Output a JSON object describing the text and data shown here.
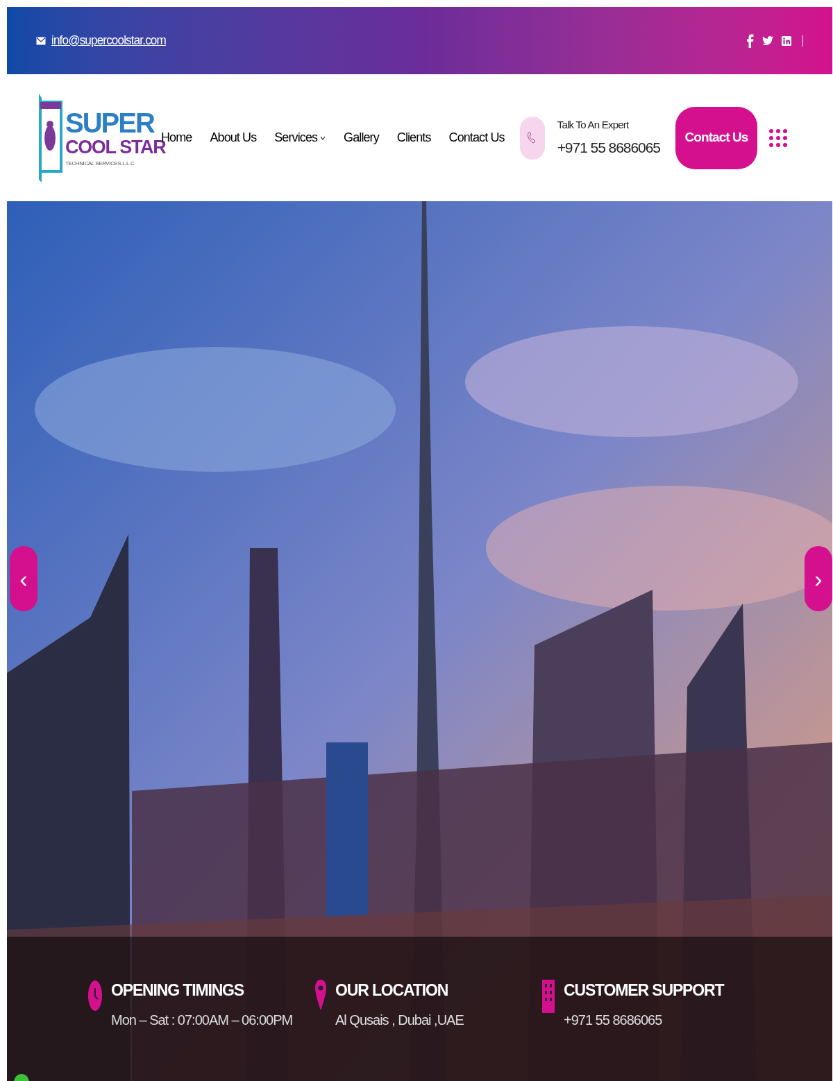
{
  "top_bar": {
    "email": "info@supercoolstar.com",
    "social": [
      {
        "kind": "facebook"
      },
      {
        "kind": "twitter"
      },
      {
        "kind": "linkedin"
      }
    ]
  },
  "logo": {
    "line_1": "SUPER",
    "line_2": "COOL STAR",
    "tagline": "TECHNICAL SERVICES L.L.C"
  },
  "nav": [
    {
      "label": "Home",
      "dropdown": false
    },
    {
      "label": "About Us",
      "dropdown": false
    },
    {
      "label": "Services",
      "dropdown": true
    },
    {
      "label": "Gallery",
      "dropdown": false
    },
    {
      "label": "Clients",
      "dropdown": false
    },
    {
      "label": "Contact Us",
      "dropdown": false
    }
  ],
  "expert": {
    "label": "Talk To An Expert",
    "phone": "+971 55 8686065"
  },
  "contact_button": "Contact Us",
  "hero": {
    "prev": "‹",
    "next": "›"
  },
  "info": [
    {
      "kind": "clock",
      "title": "OPENING TIMINGS",
      "text": "Mon – Sat : 07:00AM – 06:00PM"
    },
    {
      "kind": "pin",
      "title": "OUR LOCATION",
      "text": "Al Qusais , Dubai ,UAE"
    },
    {
      "kind": "building",
      "title": "CUSTOMER SUPPORT",
      "text": "+971 55 8686065"
    }
  ]
}
